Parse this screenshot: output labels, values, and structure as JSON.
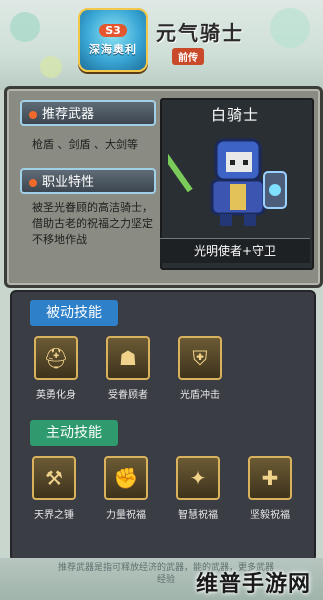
{
  "header": {
    "episode": "S3",
    "event_logo": "深海奥利",
    "game_logo": "元气骑士",
    "game_logo_sub": "前传"
  },
  "hero": {
    "name": "白骑士",
    "subtitle": "光明使者+守卫",
    "recommended_weapons_label": "推荐武器",
    "recommended_weapons": "枪盾 、剑盾 、大剑等",
    "traits_label": "职业特性",
    "traits_desc": "被圣光眷顾的高洁骑士，借助古老的祝福之力坚定不移地作战"
  },
  "passive": {
    "label": "被动技能",
    "skills": [
      {
        "name": "英勇化身",
        "icon": "helmet-icon"
      },
      {
        "name": "受眷顾者",
        "icon": "blessed-helmet-icon"
      },
      {
        "name": "光盾冲击",
        "icon": "shield-icon"
      }
    ]
  },
  "active": {
    "label": "主动技能",
    "skills": [
      {
        "name": "天界之锤",
        "icon": "hammer-icon"
      },
      {
        "name": "力量祝福",
        "icon": "power-blessing-icon"
      },
      {
        "name": "智慧祝福",
        "icon": "wisdom-blessing-icon"
      },
      {
        "name": "坚毅祝福",
        "icon": "fortitude-blessing-icon"
      }
    ]
  },
  "footer": {
    "note": "推荐武器是指可释放经济的武器，能的武器，更多武器经验"
  },
  "watermark": "维普手游网",
  "colors": {
    "passive_tag": "#2e80c8",
    "active_tag": "#2e9a6e",
    "tag_dot": "#f26a2b",
    "panel_bg": "#8a8c83"
  }
}
